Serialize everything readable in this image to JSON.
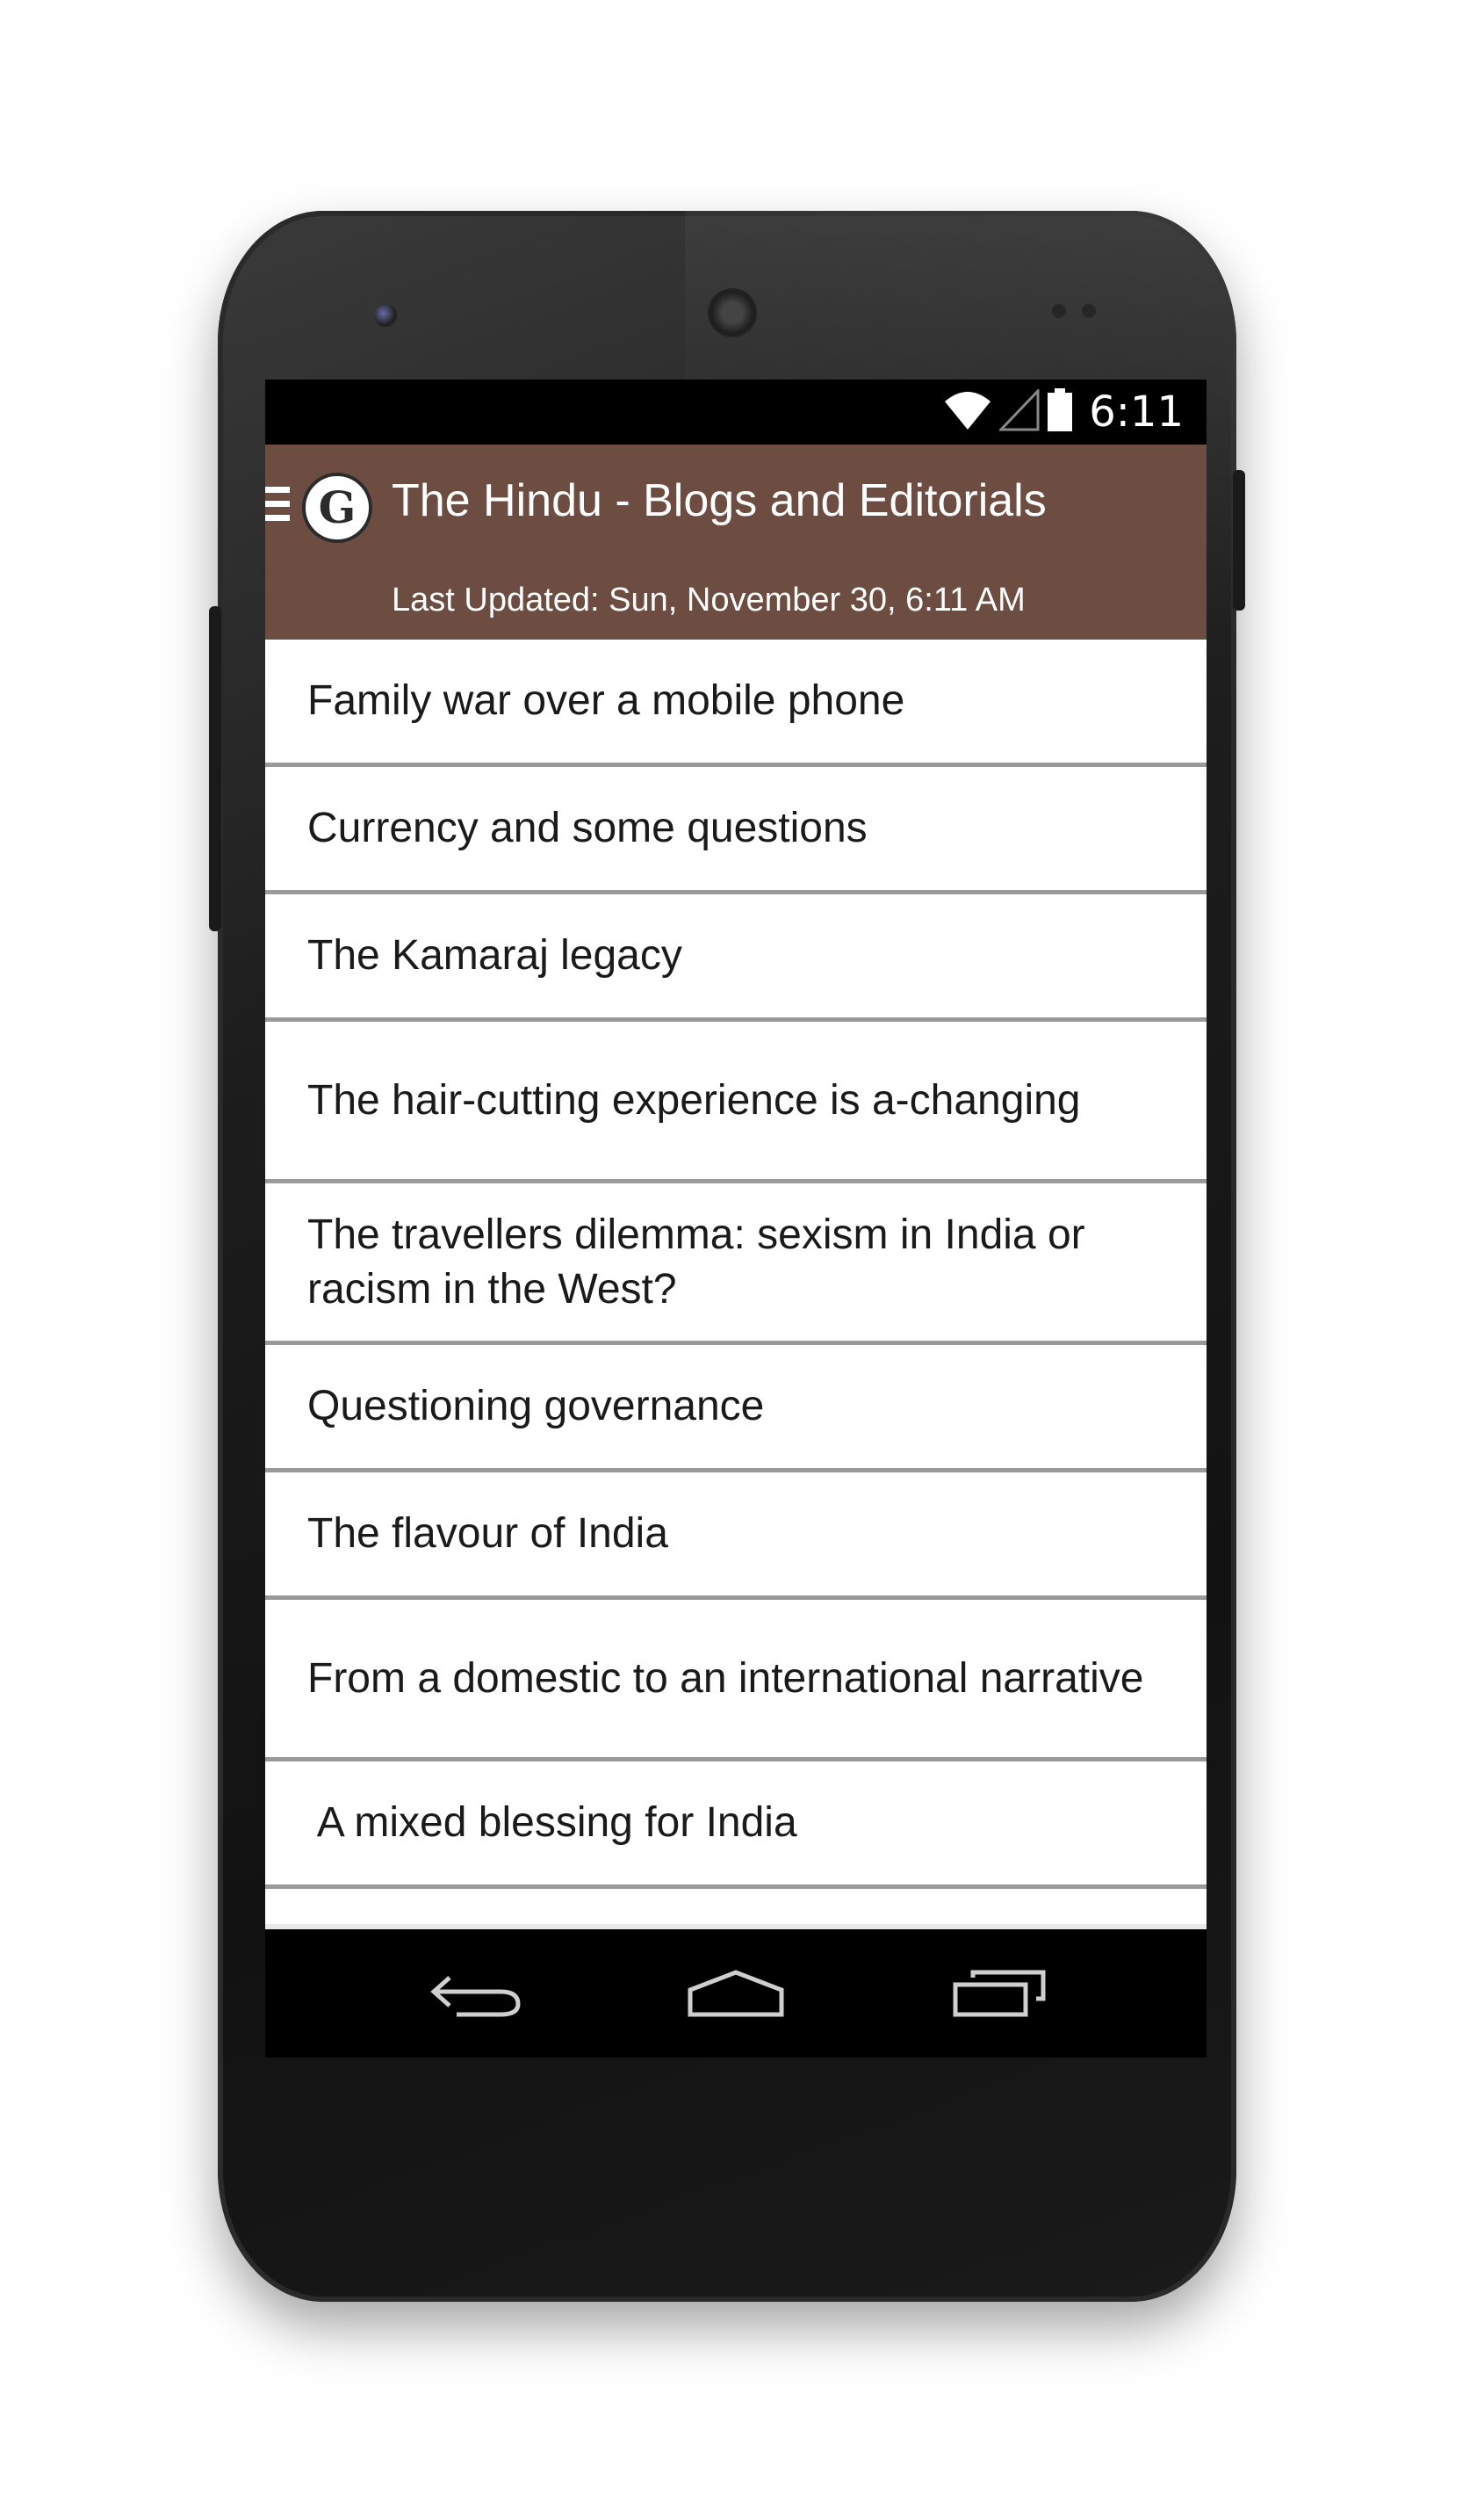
{
  "status_bar": {
    "time": "6:11",
    "icons": [
      "wifi-icon",
      "signal-icon",
      "battery-icon"
    ]
  },
  "app_bar": {
    "menu_icon": "hamburger-icon",
    "logo_icon": "the-hindu-logo",
    "title": "The Hindu - Blogs and Editorials",
    "subtitle": "Last Updated: Sun, November 30, 6:11 AM",
    "background_color": "#6d4c41"
  },
  "articles": [
    {
      "title": "Family war over a mobile phone"
    },
    {
      "title": "Currency and some questions"
    },
    {
      "title": "The Kamaraj legacy"
    },
    {
      "title": "The hair-cutting experience is a-changing"
    },
    {
      "title": "The travellers dilemma: sexism in India or racism in the West?"
    },
    {
      "title": "Questioning governance"
    },
    {
      "title": "The flavour of India"
    },
    {
      "title": "From a domestic to an international narrative"
    },
    {
      "title": " A mixed blessing for India"
    }
  ],
  "nav_bar": {
    "buttons": [
      "back-icon",
      "home-icon",
      "recent-apps-icon"
    ]
  }
}
